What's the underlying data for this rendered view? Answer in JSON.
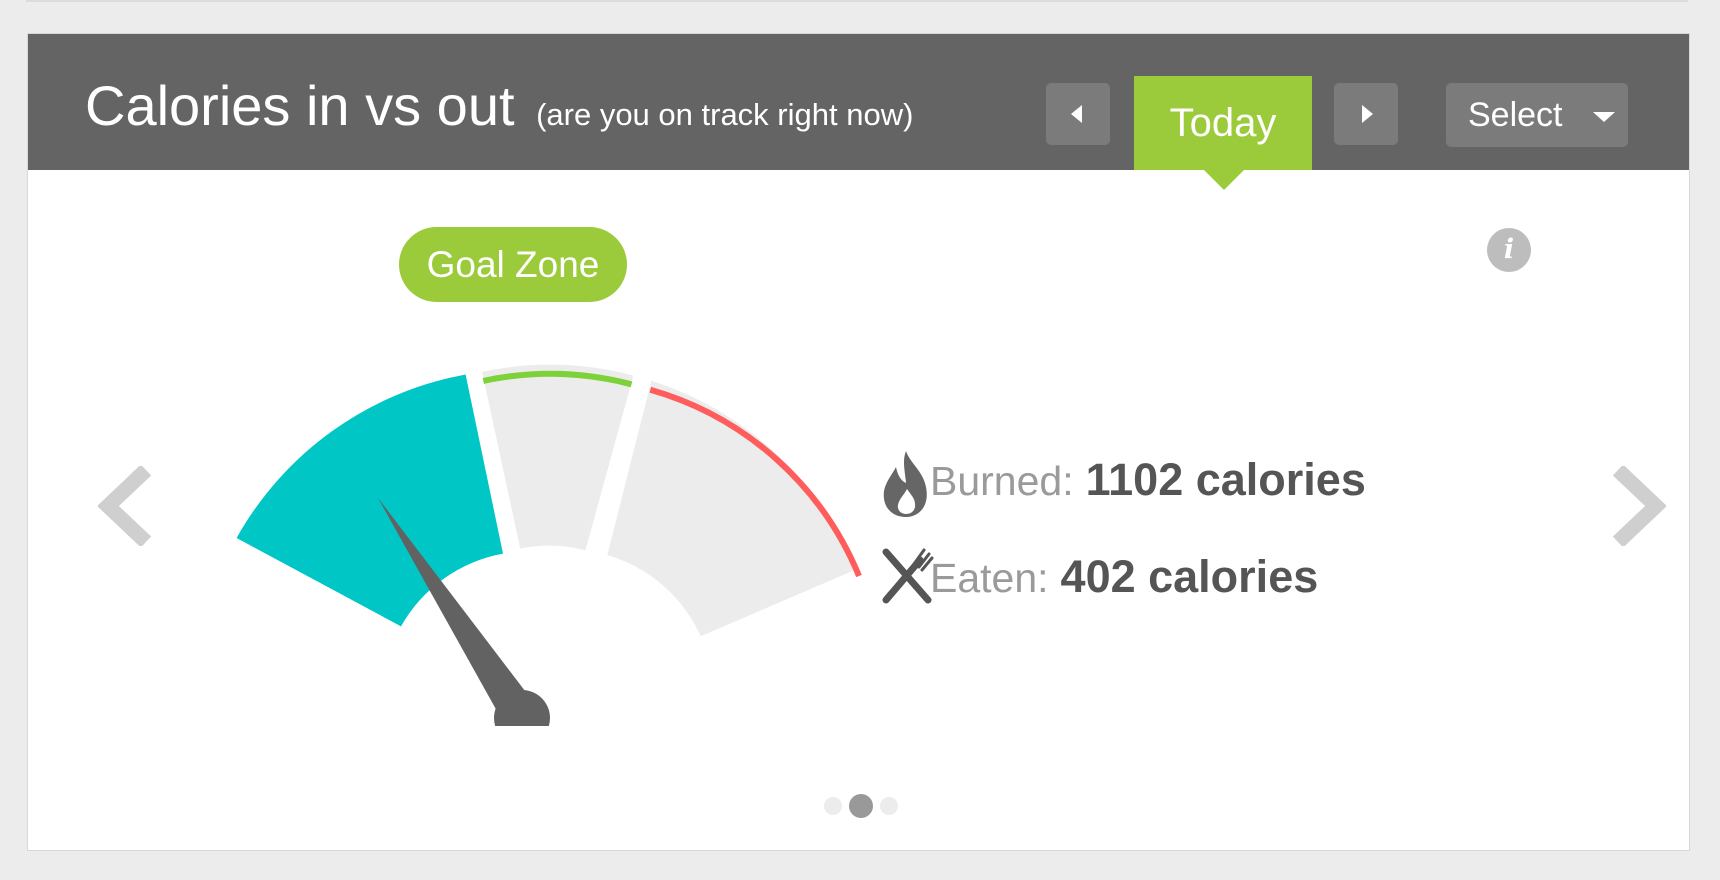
{
  "header": {
    "title": "Calories in vs out",
    "subtitle": "(are you on track right now)",
    "period_label": "Today",
    "select_label": "Select"
  },
  "gauge": {
    "zone_label": "Goal Zone",
    "needle_fraction": 0.22,
    "colors": {
      "low": "#00c6c6",
      "neutral": "#ececec",
      "goal": "#7dd23a",
      "over": "#ff5c5c",
      "needle": "#626262"
    }
  },
  "stats": {
    "burned_label": "Burned:",
    "burned_value": "1102 calories",
    "eaten_label": "Eaten:",
    "eaten_value": "402 calories"
  },
  "pagination": {
    "count": 3,
    "active_index": 1
  },
  "colors": {
    "header_bg": "#646464",
    "accent_green": "#9bcb3b",
    "button_bg": "#7b7b7b"
  },
  "icons": [
    "chevron-left-icon",
    "chevron-right-icon",
    "caret-down-icon",
    "info-icon",
    "flame-icon",
    "fork-knife-icon"
  ]
}
